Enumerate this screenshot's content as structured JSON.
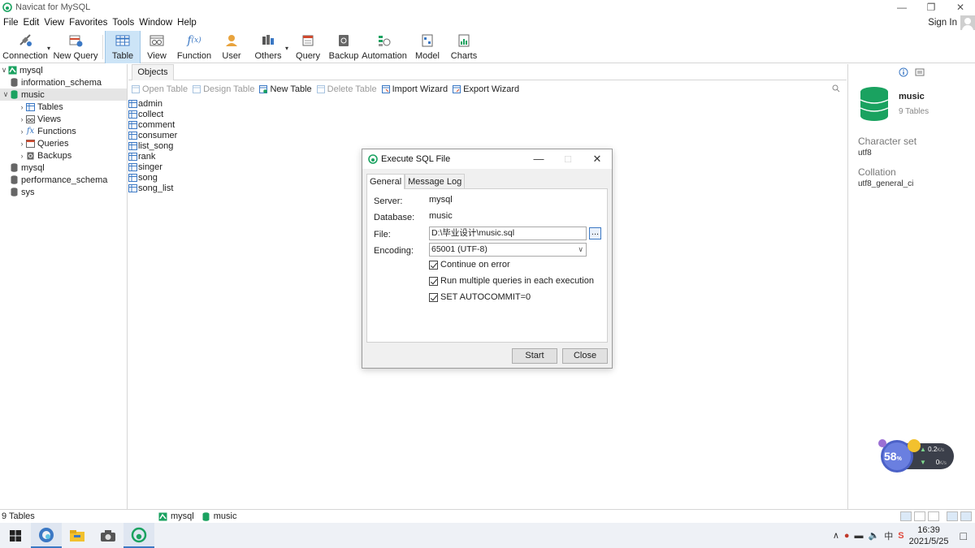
{
  "window": {
    "title": "Navicat for MySQL",
    "minimize_icon": "minimize-icon",
    "restore_icon": "restore-icon",
    "close_icon": "close-icon"
  },
  "menu": {
    "items": [
      "File",
      "Edit",
      "View",
      "Favorites",
      "Tools",
      "Window",
      "Help"
    ],
    "sign_in": "Sign In"
  },
  "toolbar": {
    "items": [
      {
        "label": "Connection",
        "icon": "connection-icon",
        "dropdown": true
      },
      {
        "label": "New Query",
        "icon": "new-query-icon"
      },
      {
        "label": "Table",
        "icon": "table-icon",
        "active": true
      },
      {
        "label": "View",
        "icon": "view-icon"
      },
      {
        "label": "Function",
        "icon": "function-icon"
      },
      {
        "label": "User",
        "icon": "user-icon"
      },
      {
        "label": "Others",
        "icon": "others-icon",
        "dropdown": true
      },
      {
        "label": "Query",
        "icon": "query-icon"
      },
      {
        "label": "Backup",
        "icon": "backup-icon"
      },
      {
        "label": "Automation",
        "icon": "automation-icon"
      },
      {
        "label": "Model",
        "icon": "model-icon"
      },
      {
        "label": "Charts",
        "icon": "charts-icon"
      }
    ]
  },
  "tree": {
    "connection": "mysql",
    "databases": [
      "information_schema",
      "music",
      "mysql",
      "performance_schema",
      "sys"
    ],
    "selected_db": "music",
    "children": [
      "Tables",
      "Views",
      "Functions",
      "Queries",
      "Backups"
    ]
  },
  "objects": {
    "tab": "Objects",
    "actions": [
      {
        "label": "Open Table",
        "enabled": false
      },
      {
        "label": "Design Table",
        "enabled": false
      },
      {
        "label": "New Table",
        "enabled": true
      },
      {
        "label": "Delete Table",
        "enabled": false
      },
      {
        "label": "Import Wizard",
        "enabled": true
      },
      {
        "label": "Export Wizard",
        "enabled": true
      }
    ],
    "tables": [
      "admin",
      "collect",
      "comment",
      "consumer",
      "list_song",
      "rank",
      "singer",
      "song",
      "song_list"
    ]
  },
  "info_panel": {
    "db_name": "music",
    "table_count": "9 Tables",
    "charset_label": "Character set",
    "charset": "utf8",
    "collation_label": "Collation",
    "collation": "utf8_general_ci"
  },
  "dialog": {
    "title": "Execute SQL File",
    "tabs": [
      "General",
      "Message Log"
    ],
    "server_label": "Server:",
    "server": "mysql",
    "database_label": "Database:",
    "database": "music",
    "file_label": "File:",
    "file": "D:\\毕业设计\\music.sql",
    "browse": "...",
    "encoding_label": "Encoding:",
    "encoding": "65001 (UTF-8)",
    "options": [
      {
        "label": "Continue on error",
        "checked": true
      },
      {
        "label": "Run multiple queries in each execution",
        "checked": true
      },
      {
        "label": "SET AUTOCOMMIT=0",
        "checked": true
      }
    ],
    "start": "Start",
    "close": "Close"
  },
  "statusbar": {
    "count": "9 Tables",
    "connection": "mysql",
    "database": "music"
  },
  "widget": {
    "percent": "58",
    "percent_unit": "%",
    "up": "0.2",
    "up_unit": "K/s",
    "down": "0",
    "down_unit": "K/s"
  },
  "taskbar": {
    "time": "16:39",
    "date": "2021/5/25"
  },
  "colors": {
    "accent": "#3b78c4",
    "navicat_green": "#1aa260",
    "toolbar_active": "#cce4f7"
  }
}
